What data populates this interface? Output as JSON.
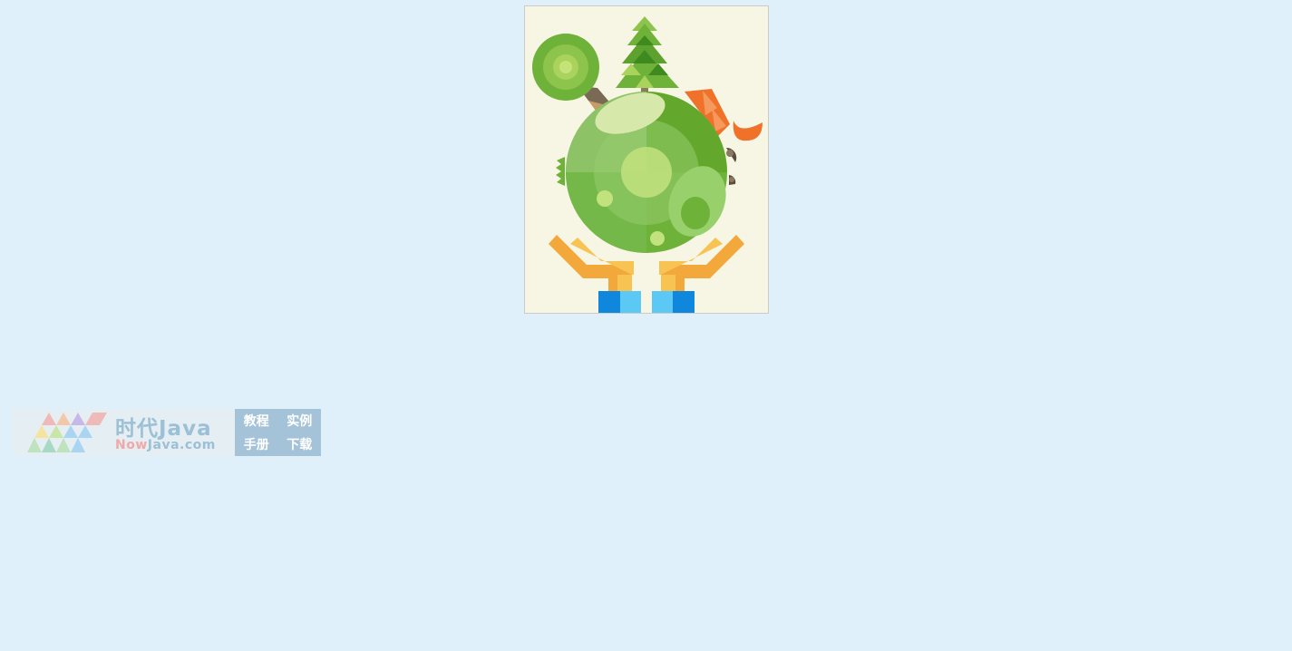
{
  "image": {
    "subject": "planet-in-hands-illustration",
    "icon": "eco-planet-icon"
  },
  "banner": {
    "title": "时代Java",
    "domain_prefix": "Now",
    "domain_suffix": "Java.com",
    "links": [
      "教程",
      "实例",
      "手册",
      "下载"
    ]
  },
  "colors": {
    "page_background": "#dff0fa",
    "illustration_background": "#f7f5e3",
    "banner_text": "#9cc0d6",
    "banner_accent": "#f0a8a8",
    "banner_links_background": "#a5c3d8"
  }
}
